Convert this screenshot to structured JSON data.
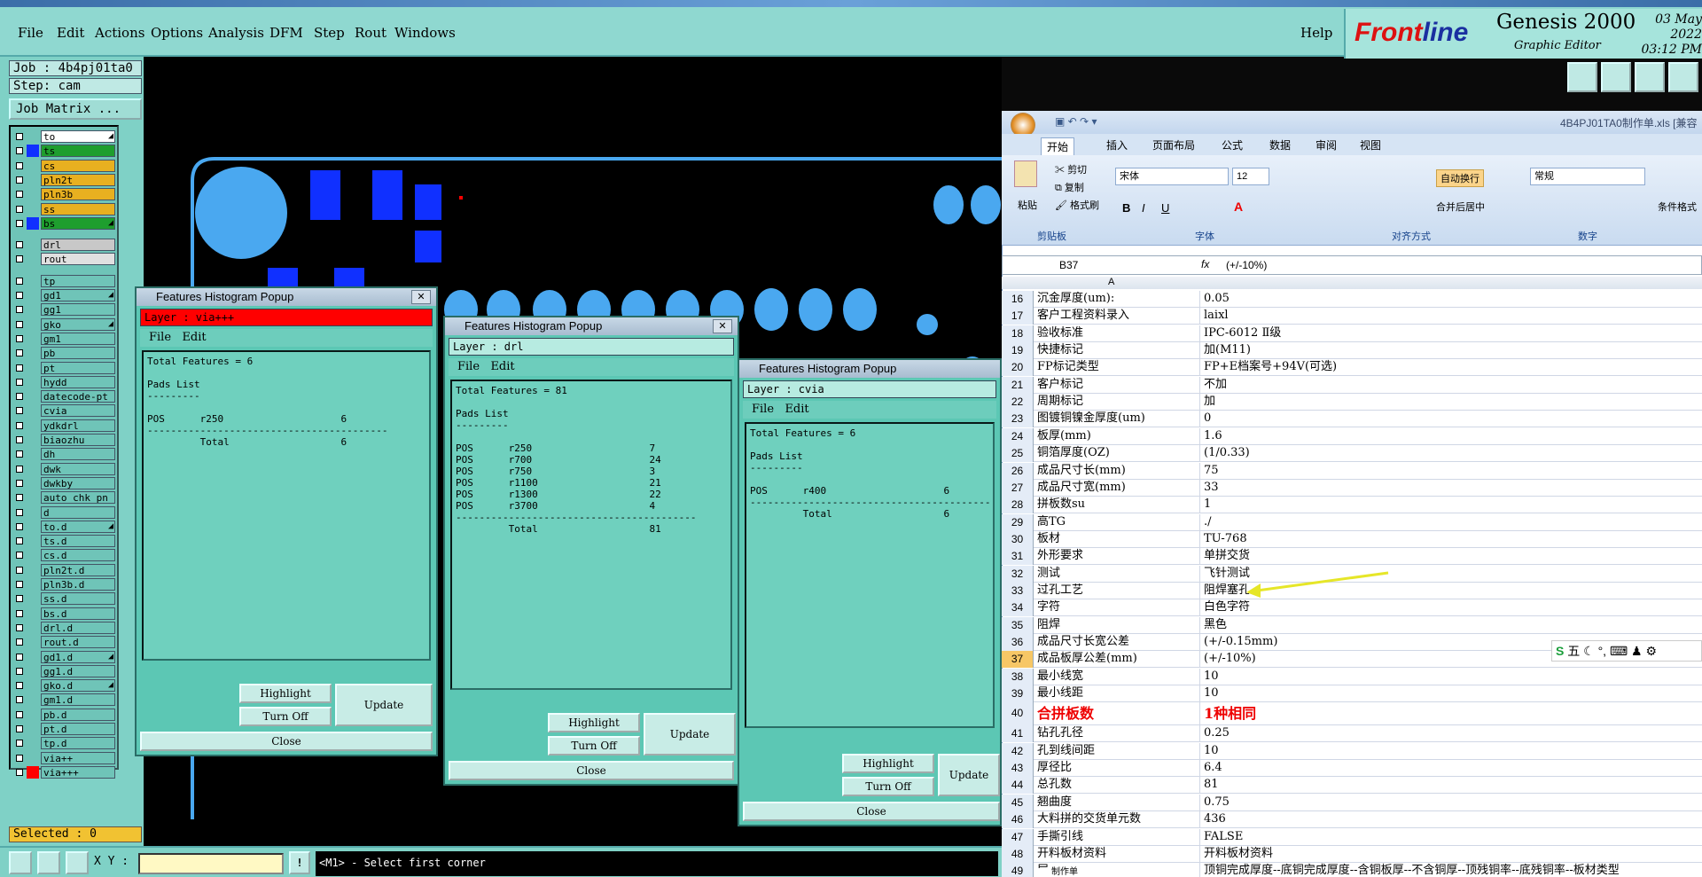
{
  "menu": {
    "items": [
      "File",
      "Edit",
      "Actions",
      "Options",
      "Analysis",
      "DFM",
      "Step",
      "Rout",
      "Windows"
    ],
    "help": "Help"
  },
  "brand": {
    "logo_a": "Front",
    "logo_b": "line",
    "genesis": "Genesis 2000",
    "editor": "Graphic Editor",
    "date": "03 May 2022",
    "time": "03:12 PM"
  },
  "job": {
    "job": "Job : 4b4pj01ta0",
    "step": "Step: cam",
    "matrix": "Job Matrix ..."
  },
  "layers": [
    {
      "name": "to",
      "color": "#ffffff",
      "mk": "◢"
    },
    {
      "name": "ts",
      "color": "#1e9e2e",
      "mk": "",
      "sw": "#1030ff"
    },
    {
      "name": "cs",
      "color": "#e8b020",
      "mk": ""
    },
    {
      "name": "pln2t",
      "color": "#e8b020",
      "mk": ""
    },
    {
      "name": "pln3b",
      "color": "#e8b020",
      "mk": ""
    },
    {
      "name": "ss",
      "color": "#e8b020",
      "mk": ""
    },
    {
      "name": "bs",
      "color": "#1e9e2e",
      "mk": "◢",
      "sw": "#1030ff"
    },
    {
      "name": "drl",
      "color": "#c8c8c8",
      "mk": ""
    },
    {
      "name": "rout",
      "color": "#e0e0e0",
      "mk": ""
    },
    {
      "name": "tp",
      "color": "#6fc4b8",
      "mk": ""
    },
    {
      "name": "gd1",
      "color": "#6fc4b8",
      "mk": "◢"
    },
    {
      "name": "gg1",
      "color": "#6fc4b8",
      "mk": ""
    },
    {
      "name": "gko",
      "color": "#6fc4b8",
      "mk": "◢"
    },
    {
      "name": "gm1",
      "color": "#6fc4b8",
      "mk": ""
    },
    {
      "name": "pb",
      "color": "#6fc4b8",
      "mk": ""
    },
    {
      "name": "pt",
      "color": "#6fc4b8",
      "mk": ""
    },
    {
      "name": "hydd",
      "color": "#6fc4b8",
      "mk": ""
    },
    {
      "name": "datecode-pt",
      "color": "#6fc4b8",
      "mk": ""
    },
    {
      "name": "cvia",
      "color": "#6fc4b8",
      "mk": ""
    },
    {
      "name": "ydkdrl",
      "color": "#6fc4b8",
      "mk": ""
    },
    {
      "name": "biaozhu",
      "color": "#6fc4b8",
      "mk": ""
    },
    {
      "name": "dh",
      "color": "#6fc4b8",
      "mk": ""
    },
    {
      "name": "dwk",
      "color": "#6fc4b8",
      "mk": ""
    },
    {
      "name": "dwkby",
      "color": "#6fc4b8",
      "mk": ""
    },
    {
      "name": "auto_chk_pn",
      "color": "#6fc4b8",
      "mk": ""
    },
    {
      "name": "d",
      "color": "#6fc4b8",
      "mk": ""
    },
    {
      "name": "to.d",
      "color": "#6fc4b8",
      "mk": "◢"
    },
    {
      "name": "ts.d",
      "color": "#6fc4b8",
      "mk": ""
    },
    {
      "name": "cs.d",
      "color": "#6fc4b8",
      "mk": ""
    },
    {
      "name": "pln2t.d",
      "color": "#6fc4b8",
      "mk": ""
    },
    {
      "name": "pln3b.d",
      "color": "#6fc4b8",
      "mk": ""
    },
    {
      "name": "ss.d",
      "color": "#6fc4b8",
      "mk": ""
    },
    {
      "name": "bs.d",
      "color": "#6fc4b8",
      "mk": ""
    },
    {
      "name": "drl.d",
      "color": "#6fc4b8",
      "mk": ""
    },
    {
      "name": "rout.d",
      "color": "#6fc4b8",
      "mk": ""
    },
    {
      "name": "gd1.d",
      "color": "#6fc4b8",
      "mk": "◢"
    },
    {
      "name": "gg1.d",
      "color": "#6fc4b8",
      "mk": ""
    },
    {
      "name": "gko.d",
      "color": "#6fc4b8",
      "mk": "◢"
    },
    {
      "name": "gm1.d",
      "color": "#6fc4b8",
      "mk": ""
    },
    {
      "name": "pb.d",
      "color": "#6fc4b8",
      "mk": ""
    },
    {
      "name": "pt.d",
      "color": "#6fc4b8",
      "mk": ""
    },
    {
      "name": "tp.d",
      "color": "#6fc4b8",
      "mk": ""
    },
    {
      "name": "via++",
      "color": "#6fc4b8",
      "mk": ""
    },
    {
      "name": "via+++",
      "color": "#6fc4b8",
      "mk": "",
      "sw": "#f00"
    }
  ],
  "selected": "Selected : 0",
  "bottom": {
    "xy_label": "X Y :",
    "prompt": "<M1> - Select first corner"
  },
  "popups": [
    {
      "title": "Features Histogram Popup",
      "layer": "Layer : via+++",
      "file": "File",
      "edit": "Edit",
      "body": "Total Features = 6\n\nPads List\n---------\n\nPOS      r250                    6\n-----------------------------------------\n         Total                   6",
      "highlight": "Highlight",
      "turnoff": "Turn Off",
      "update": "Update",
      "close": "Close"
    },
    {
      "title": "Features Histogram Popup",
      "layer": "Layer : drl",
      "file": "File",
      "edit": "Edit",
      "body": "Total Features = 81\n\nPads List\n---------\n\nPOS      r250                    7\nPOS      r700                    24\nPOS      r750                    3\nPOS      r1100                   21\nPOS      r1300                   22\nPOS      r3700                   4\n-----------------------------------------\n         Total                   81",
      "highlight": "Highlight",
      "turnoff": "Turn Off",
      "update": "Update",
      "close": "Close"
    },
    {
      "title": "Features Histogram Popup",
      "layer": "Layer : cvia",
      "file": "File",
      "edit": "Edit",
      "body": "Total Features = 6\n\nPads List\n---------\n\nPOS      r400                    6\n-----------------------------------------\n         Total                   6",
      "highlight": "Highlight",
      "turnoff": "Turn Off",
      "update": "Update",
      "close": "Close"
    }
  ],
  "excel": {
    "title": "4B4PJ01TA0制作单.xls  [兼容",
    "tabs": [
      "开始",
      "插入",
      "页面布局",
      "公式",
      "数据",
      "审阅",
      "视图"
    ],
    "ribbon": {
      "paste": "粘贴",
      "cut": "剪切",
      "copy": "复制",
      "format_painter": "格式刷",
      "clipboard": "剪贴板",
      "font_name": "宋体",
      "font_size": "12",
      "font": "字体",
      "wrap": "自动换行",
      "merge": "合并后居中",
      "align": "对齐方式",
      "numfmt": "常规",
      "number": "数字",
      "cond": "条件格式"
    },
    "cell_ref": "B37",
    "formula": "(+/-10%)",
    "col_a": "A",
    "rows": [
      [
        "16",
        "沉金厚度(um):",
        "0.05"
      ],
      [
        "17",
        "客户工程资料录入",
        "laixl"
      ],
      [
        "18",
        "验收标准",
        "IPC-6012 Ⅱ级"
      ],
      [
        "19",
        "快捷标记",
        "加(M11)"
      ],
      [
        "20",
        "FP标记类型",
        "FP+E档案号+94V(可选)"
      ],
      [
        "21",
        "客户标记",
        "不加"
      ],
      [
        "22",
        "周期标记",
        "加"
      ],
      [
        "23",
        "图镀铜镍金厚度(um)",
        "0"
      ],
      [
        "24",
        "板厚(mm)",
        "1.6"
      ],
      [
        "25",
        "铜箔厚度(OZ)",
        "(1/0.33)"
      ],
      [
        "26",
        "成品尺寸长(mm)",
        "75"
      ],
      [
        "27",
        "成品尺寸宽(mm)",
        "33"
      ],
      [
        "28",
        "拼板数su",
        "1"
      ],
      [
        "29",
        "高TG",
        "./"
      ],
      [
        "30",
        "板材",
        "TU-768"
      ],
      [
        "31",
        "外形要求",
        "单拼交货"
      ],
      [
        "32",
        "测试",
        "飞针测试"
      ],
      [
        "33",
        "过孔工艺",
        "阻焊塞孔"
      ],
      [
        "34",
        "字符",
        "白色字符"
      ],
      [
        "35",
        "阻焊",
        "黑色"
      ],
      [
        "36",
        "成品尺寸长宽公差",
        "(+/-0.15mm)"
      ],
      [
        "37",
        "成品板厚公差(mm)",
        "(+/-10%)"
      ],
      [
        "38",
        "最小线宽",
        "10"
      ],
      [
        "39",
        "最小线距",
        "10"
      ],
      [
        "40",
        "合拼板数",
        "1种相同"
      ],
      [
        "41",
        "钻孔孔径",
        "0.25"
      ],
      [
        "42",
        "孔到线间距",
        "10"
      ],
      [
        "43",
        "厚径比",
        "6.4"
      ],
      [
        "44",
        "总孔数",
        "81"
      ],
      [
        "45",
        "翘曲度",
        "0.75"
      ],
      [
        "46",
        "大料拼的交货单元数",
        "436"
      ],
      [
        "47",
        "手撕引线",
        "FALSE"
      ],
      [
        "48",
        "开料板材资料",
        "开料板材资料"
      ],
      [
        "49",
        "层",
        "顶铜完成厚度--底铜完成厚度--含铜板厚--不含铜厚--顶残铜率--底残铜率--板材类型"
      ]
    ],
    "sheet_tab": "制作单",
    "ime": "五"
  },
  "colors": {
    "panel": "#7fd1c6",
    "popup": "#5cc7b4",
    "pad": "#4aa8f0"
  }
}
